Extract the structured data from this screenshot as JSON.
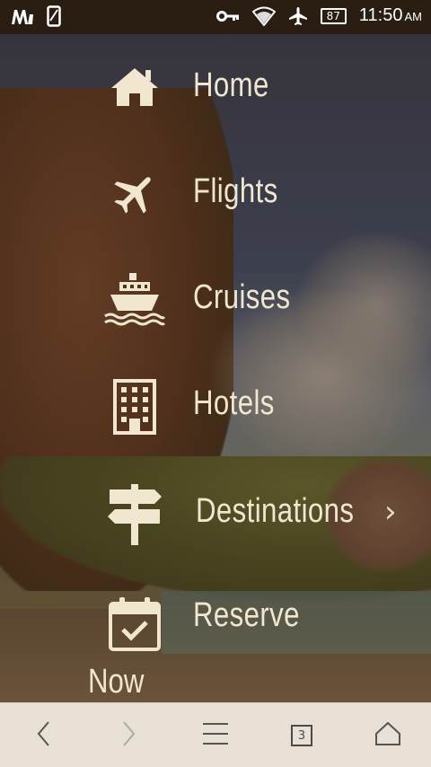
{
  "status_bar": {
    "battery": "87",
    "time": "11:50",
    "ampm": "AM",
    "left_icons": [
      "app-m-icon",
      "phone-icon"
    ],
    "right_icons": [
      "key-icon",
      "wifi-icon",
      "airplane-icon",
      "battery-icon"
    ]
  },
  "menu": {
    "items": [
      {
        "label": "Home",
        "icon": "home-icon"
      },
      {
        "label": "Flights",
        "icon": "airplane-icon"
      },
      {
        "label": "Cruises",
        "icon": "ship-icon"
      },
      {
        "label": "Hotels",
        "icon": "building-icon"
      },
      {
        "label": "Destinations",
        "icon": "signpost-icon",
        "has_chevron": true
      },
      {
        "label": "Reserve",
        "icon": "calendar-check-icon"
      }
    ],
    "overflow_text": "Now"
  },
  "toolbar": {
    "tab_count": "3",
    "icons": [
      "back-icon",
      "forward-icon",
      "menu-icon",
      "tabs-icon",
      "home-icon"
    ]
  },
  "colors": {
    "menu_text": "#f1e6cf",
    "status_bar_bg": "#2a1d12",
    "toolbar_bg": "#e8e0d4"
  }
}
